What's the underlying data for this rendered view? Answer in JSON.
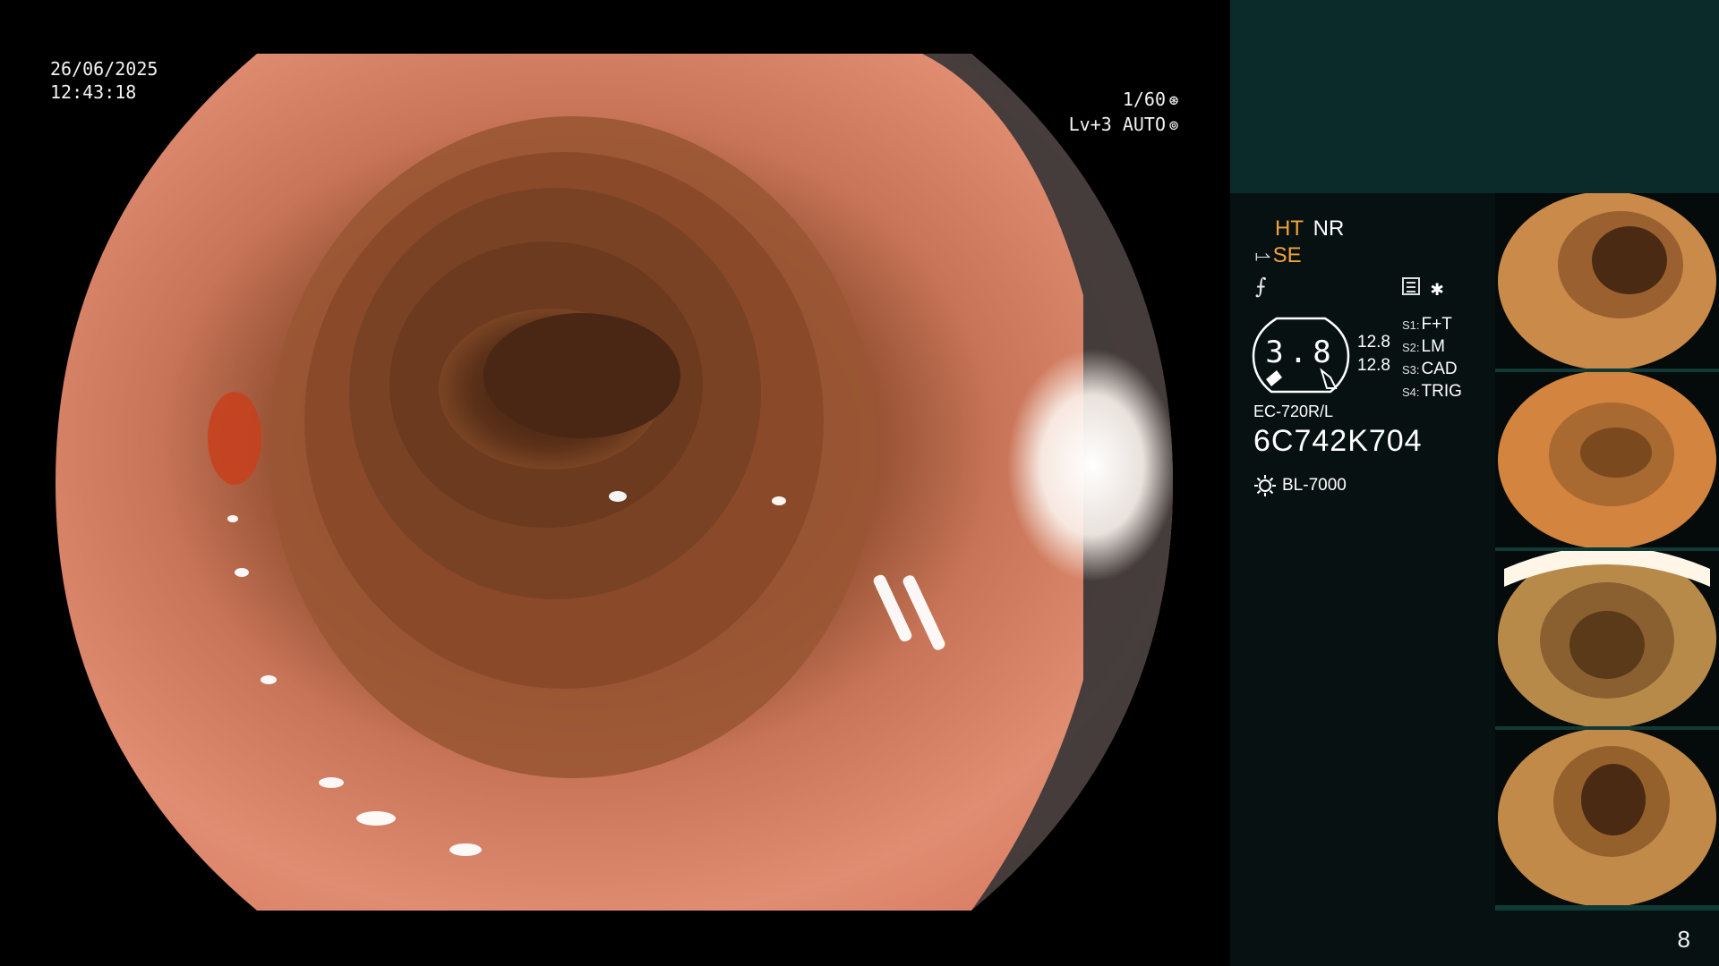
{
  "main_view": {
    "date": "26/06/2025",
    "time": "12:43:18",
    "shutter": "1/60",
    "level": "Lv+3",
    "iris_mode": "AUTO"
  },
  "status": {
    "mode_ht": "HT",
    "mode_nr": "NR",
    "se_label": "SE"
  },
  "zoom": {
    "value": "3.8",
    "value_a": "12.8",
    "value_b": "12.8"
  },
  "switches": [
    {
      "key": "S1:",
      "value": "F+T"
    },
    {
      "key": "S2:",
      "value": "LM"
    },
    {
      "key": "S3:",
      "value": "CAD"
    },
    {
      "key": "S4:",
      "value": "TRIG"
    }
  ],
  "scope": {
    "model": "EC-720R/L",
    "serial": "6C742K704"
  },
  "light_source": {
    "name": "BL-7000"
  },
  "thumbnails": [
    {
      "name": "thumb-1"
    },
    {
      "name": "thumb-2"
    },
    {
      "name": "thumb-3"
    },
    {
      "name": "thumb-4"
    }
  ],
  "page_number": "8",
  "colors": {
    "accent_orange": "#f3a23a",
    "panel_teal": "#0b2b2b",
    "panel_dark": "#071112"
  },
  "icons": [
    "shutter-icon",
    "iris-icon",
    "se-icon",
    "function-icon",
    "memo-icon",
    "star-icon",
    "light-source-icon"
  ]
}
